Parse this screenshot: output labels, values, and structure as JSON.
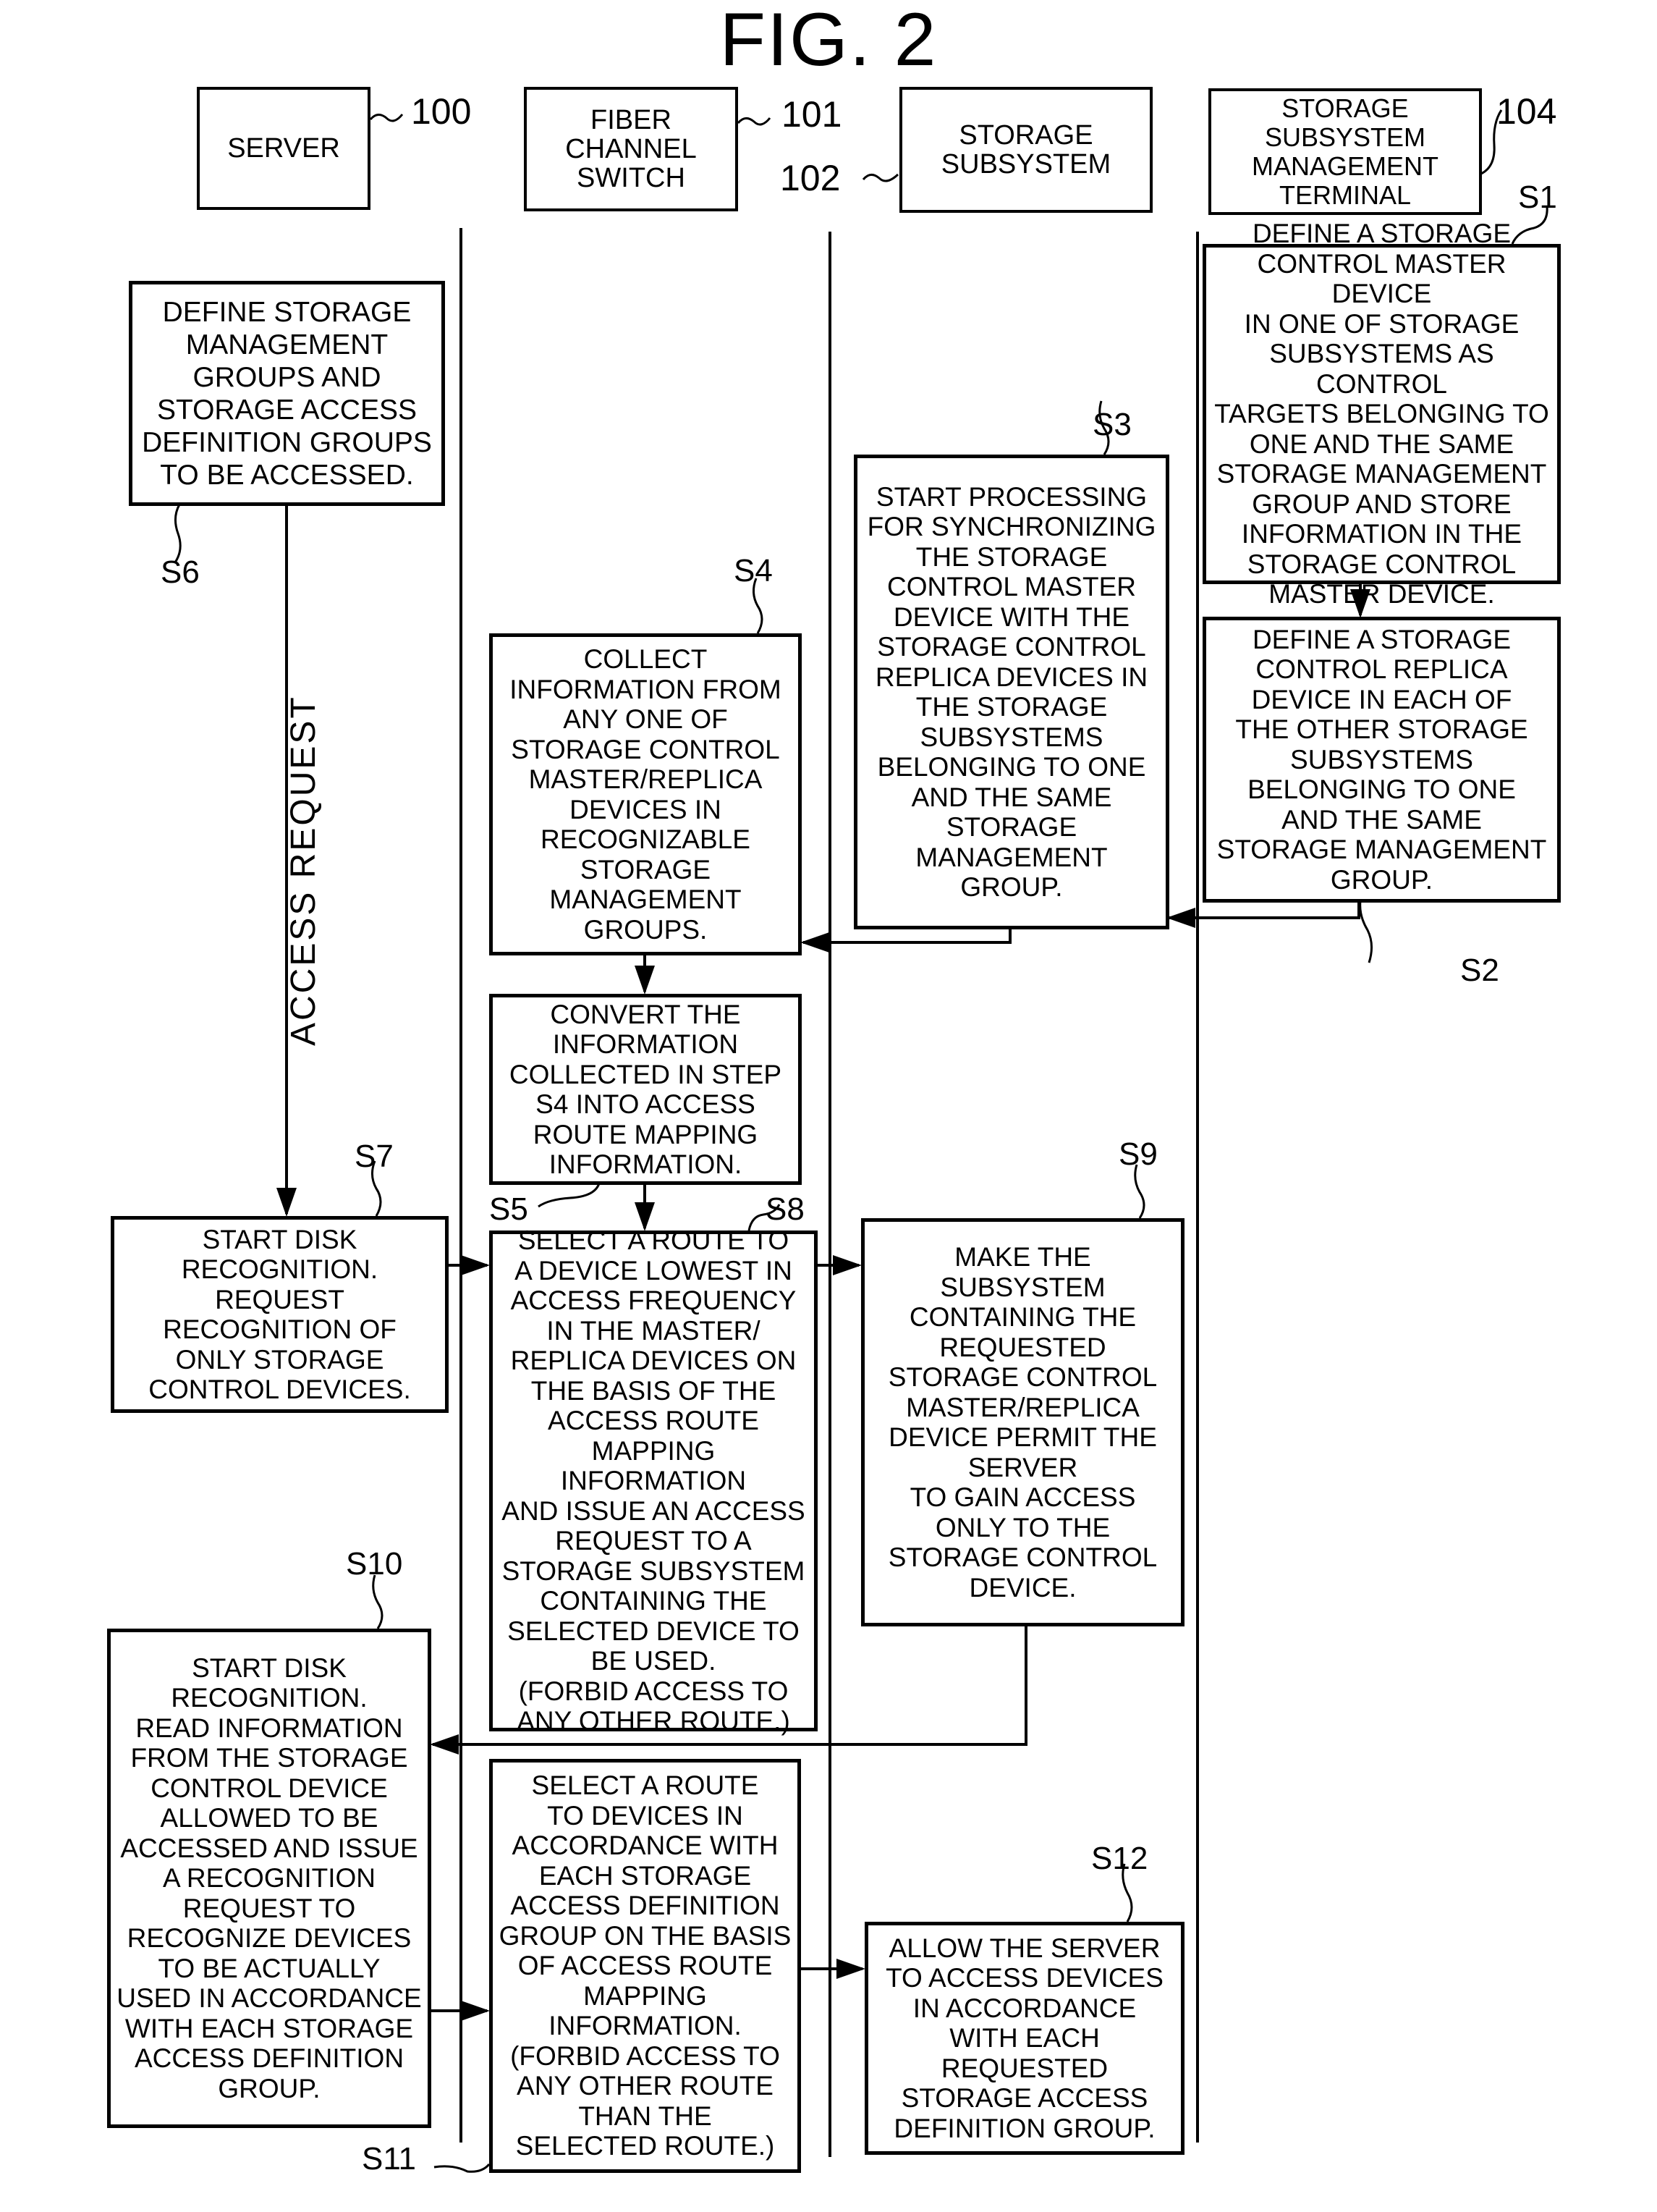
{
  "figure": {
    "title": "FIG. 2"
  },
  "entities": [
    {
      "id": "server",
      "label": "SERVER",
      "ref": "100"
    },
    {
      "id": "fc-switch",
      "label": "FIBER\nCHANNEL\nSWITCH",
      "ref": "101"
    },
    {
      "id": "storage-subsystem",
      "label": "STORAGE\nSUBSYSTEM",
      "ref": "102"
    },
    {
      "id": "mgmt-terminal",
      "label": "STORAGE\nSUBSYSTEM\nMANAGEMENT\nTERMINAL",
      "ref": "104"
    }
  ],
  "steps": {
    "S1": {
      "label": "S1",
      "text": "DEFINE A STORAGE\nCONTROL MASTER DEVICE\nIN ONE OF STORAGE\nSUBSYSTEMS AS CONTROL\nTARGETS BELONGING TO\nONE AND THE SAME\nSTORAGE MANAGEMENT\nGROUP AND STORE\nINFORMATION IN THE\nSTORAGE CONTROL\nMASTER DEVICE."
    },
    "S2": {
      "label": "S2",
      "text": "DEFINE A STORAGE\nCONTROL REPLICA\nDEVICE IN EACH OF\nTHE OTHER STORAGE\nSUBSYSTEMS\nBELONGING TO ONE\nAND THE SAME\nSTORAGE MANAGEMENT\nGROUP."
    },
    "S3": {
      "label": "S3",
      "text": "START PROCESSING\nFOR SYNCHRONIZING\nTHE STORAGE\nCONTROL MASTER\nDEVICE WITH THE\nSTORAGE CONTROL\nREPLICA DEVICES IN\nTHE STORAGE\nSUBSYSTEMS\nBELONGING TO ONE\nAND THE SAME\nSTORAGE\nMANAGEMENT\nGROUP."
    },
    "S4": {
      "label": "S4",
      "text": "COLLECT\nINFORMATION FROM\nANY ONE OF\nSTORAGE CONTROL\nMASTER/REPLICA\nDEVICES IN\nRECOGNIZABLE\nSTORAGE\nMANAGEMENT\nGROUPS."
    },
    "S5": {
      "label": "S5",
      "text": "CONVERT THE\nINFORMATION\nCOLLECTED IN STEP\nS4 INTO ACCESS\nROUTE MAPPING\nINFORMATION."
    },
    "S6": {
      "label": "S6",
      "text": "DEFINE STORAGE\nMANAGEMENT\nGROUPS AND\nSTORAGE ACCESS\nDEFINITION GROUPS\nTO BE ACCESSED."
    },
    "S7": {
      "label": "S7",
      "text": "START DISK\nRECOGNITION.\nREQUEST\nRECOGNITION OF\nONLY STORAGE\nCONTROL DEVICES."
    },
    "S8": {
      "label": "S8",
      "text": "SELECT A ROUTE TO\nA DEVICE LOWEST IN\nACCESS FREQUENCY\nIN THE MASTER/\nREPLICA DEVICES ON\nTHE BASIS OF THE\nACCESS ROUTE\nMAPPING INFORMATION\nAND ISSUE AN ACCESS\nREQUEST TO A\nSTORAGE SUBSYSTEM\nCONTAINING THE\nSELECTED DEVICE TO\nBE USED.\n(FORBID ACCESS TO\nANY OTHER ROUTE.)"
    },
    "S9": {
      "label": "S9",
      "text": "MAKE THE\nSUBSYSTEM\nCONTAINING THE\nREQUESTED\nSTORAGE CONTROL\nMASTER/REPLICA\nDEVICE PERMIT THE\nSERVER\nTO GAIN ACCESS\nONLY TO THE\nSTORAGE CONTROL\nDEVICE."
    },
    "S10": {
      "label": "S10",
      "text": "START DISK\nRECOGNITION.\nREAD INFORMATION\nFROM THE STORAGE\nCONTROL DEVICE\nALLOWED TO BE\nACCESSED AND ISSUE\nA RECOGNITION\nREQUEST TO\nRECOGNIZE DEVICES\nTO BE ACTUALLY\nUSED IN ACCORDANCE\nWITH EACH STORAGE\nACCESS DEFINITION\nGROUP."
    },
    "S11": {
      "label": "S11",
      "text": "SELECT A ROUTE\nTO DEVICES IN\nACCORDANCE WITH\nEACH STORAGE\nACCESS DEFINITION\nGROUP ON THE BASIS\nOF ACCESS ROUTE\nMAPPING\nINFORMATION.\n(FORBID ACCESS TO\nANY OTHER ROUTE\nTHAN THE\nSELECTED ROUTE.)"
    },
    "S12": {
      "label": "S12",
      "text": "ALLOW THE SERVER\nTO ACCESS DEVICES\nIN ACCORDANCE\nWITH EACH\nREQUESTED\nSTORAGE ACCESS\nDEFINITION GROUP."
    }
  },
  "annotations": {
    "access_request": "ACCESS REQUEST"
  }
}
